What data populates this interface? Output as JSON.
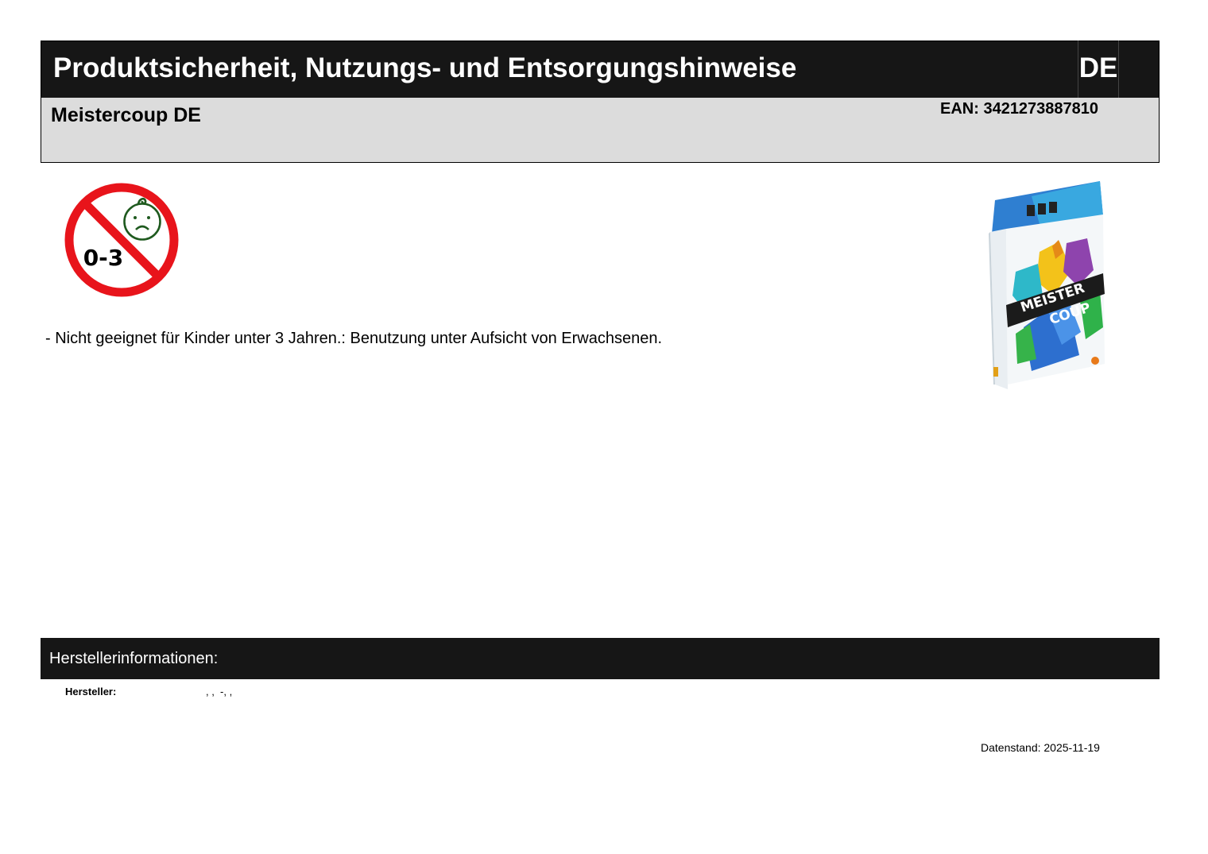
{
  "header": {
    "title": "Produktsicherheit, Nutzungs- und Entsorgungshinweise",
    "language": "DE"
  },
  "product": {
    "name": "Meistercoup DE",
    "ean": "EAN: 3421273887810",
    "box_text_line1": "MEISTER",
    "box_text_line2": "COUP"
  },
  "warning": {
    "age_icon_text": "0-3",
    "note": "- Nicht geeignet für Kinder unter 3 Jahren.: Benutzung unter Aufsicht von Erwachsenen."
  },
  "manufacturer": {
    "section_title": "Herstellerinformationen:",
    "label": "Hersteller:",
    "value": ", ,  -, ,"
  },
  "footer": {
    "date_stand": "Datenstand: 2025-11-19"
  },
  "colors": {
    "bar_dark": "#161616",
    "bar_light": "#dcdcdc",
    "warning_red": "#e8141b",
    "face_green": "#1f5a1f"
  }
}
